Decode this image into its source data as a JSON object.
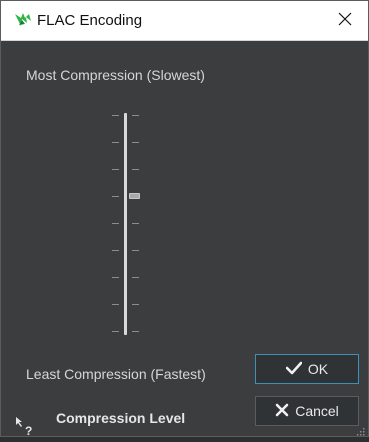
{
  "window": {
    "title": "FLAC Encoding"
  },
  "icons": {
    "app": "flac-app-icon",
    "close": "close-icon",
    "ok_check": "checkmark-icon",
    "cancel_x": "x-icon",
    "help": "whats-this-help-icon",
    "grip": "resize-grip-icon"
  },
  "labels": {
    "most": "Most Compression (Slowest)",
    "least": "Least Compression (Fastest)",
    "compression_level": "Compression Level"
  },
  "slider": {
    "min": 0,
    "max": 8,
    "value": 5
  },
  "buttons": {
    "ok": "OK",
    "cancel": "Cancel"
  },
  "colors": {
    "accent": "#3f8fb8",
    "app_icon_green": "#2fb44a"
  }
}
